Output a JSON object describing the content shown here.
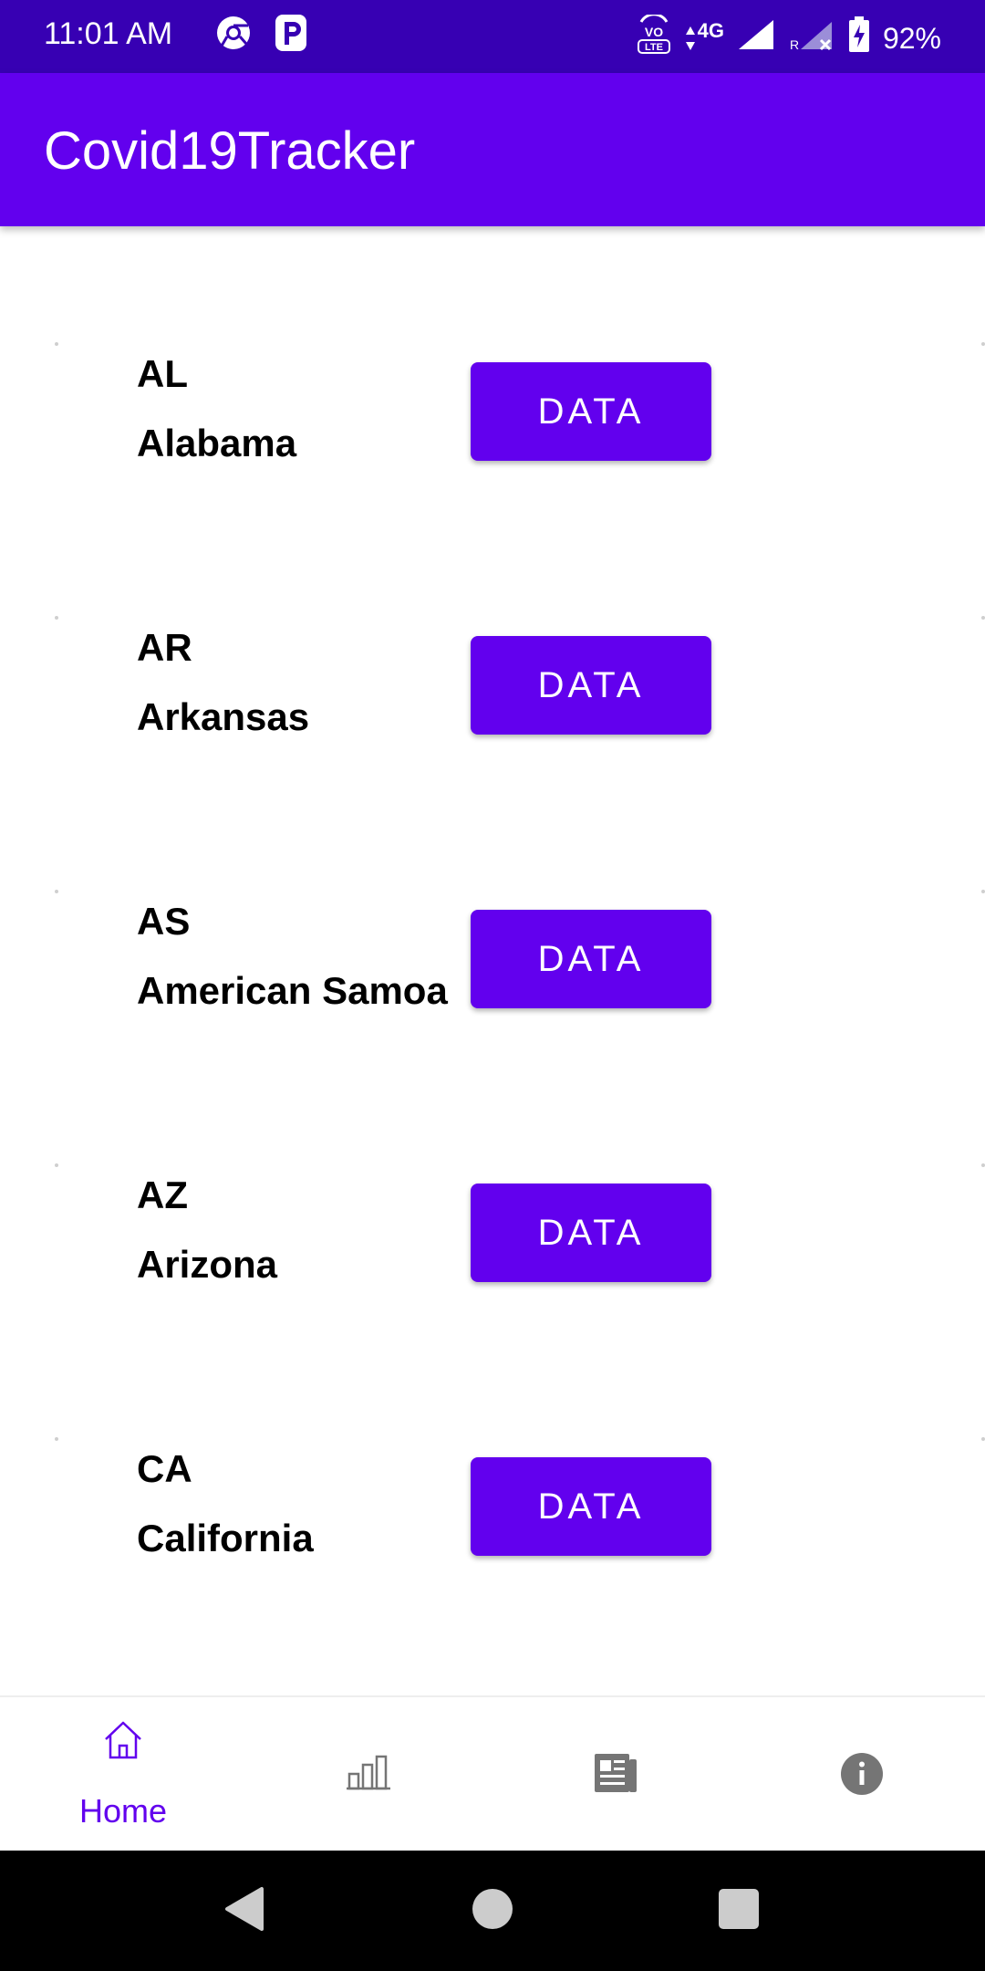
{
  "status_bar": {
    "time": "11:01 AM",
    "network": "4G",
    "battery": "92%",
    "icons": [
      "chrome-icon",
      "p-app-icon",
      "volte-icon",
      "signal-icon",
      "battery-icon"
    ]
  },
  "app_bar": {
    "title": "Covid19Tracker"
  },
  "states": [
    {
      "code": "AL",
      "name": "Alabama",
      "button": "DATA"
    },
    {
      "code": "AR",
      "name": "Arkansas",
      "button": "DATA"
    },
    {
      "code": "AS",
      "name": "American Samoa",
      "button": "DATA"
    },
    {
      "code": "AZ",
      "name": "Arizona",
      "button": "DATA"
    },
    {
      "code": "CA",
      "name": "California",
      "button": "DATA"
    }
  ],
  "bottom_nav": {
    "items": [
      {
        "label": "Home",
        "icon": "home-icon",
        "active": true
      },
      {
        "label": "",
        "icon": "bar-chart-icon",
        "active": false
      },
      {
        "label": "",
        "icon": "news-icon",
        "active": false
      },
      {
        "label": "",
        "icon": "info-icon",
        "active": false
      }
    ]
  },
  "colors": {
    "primary": "#6200ee",
    "primary_dark": "#3700b3",
    "inactive_icon": "#757575"
  }
}
